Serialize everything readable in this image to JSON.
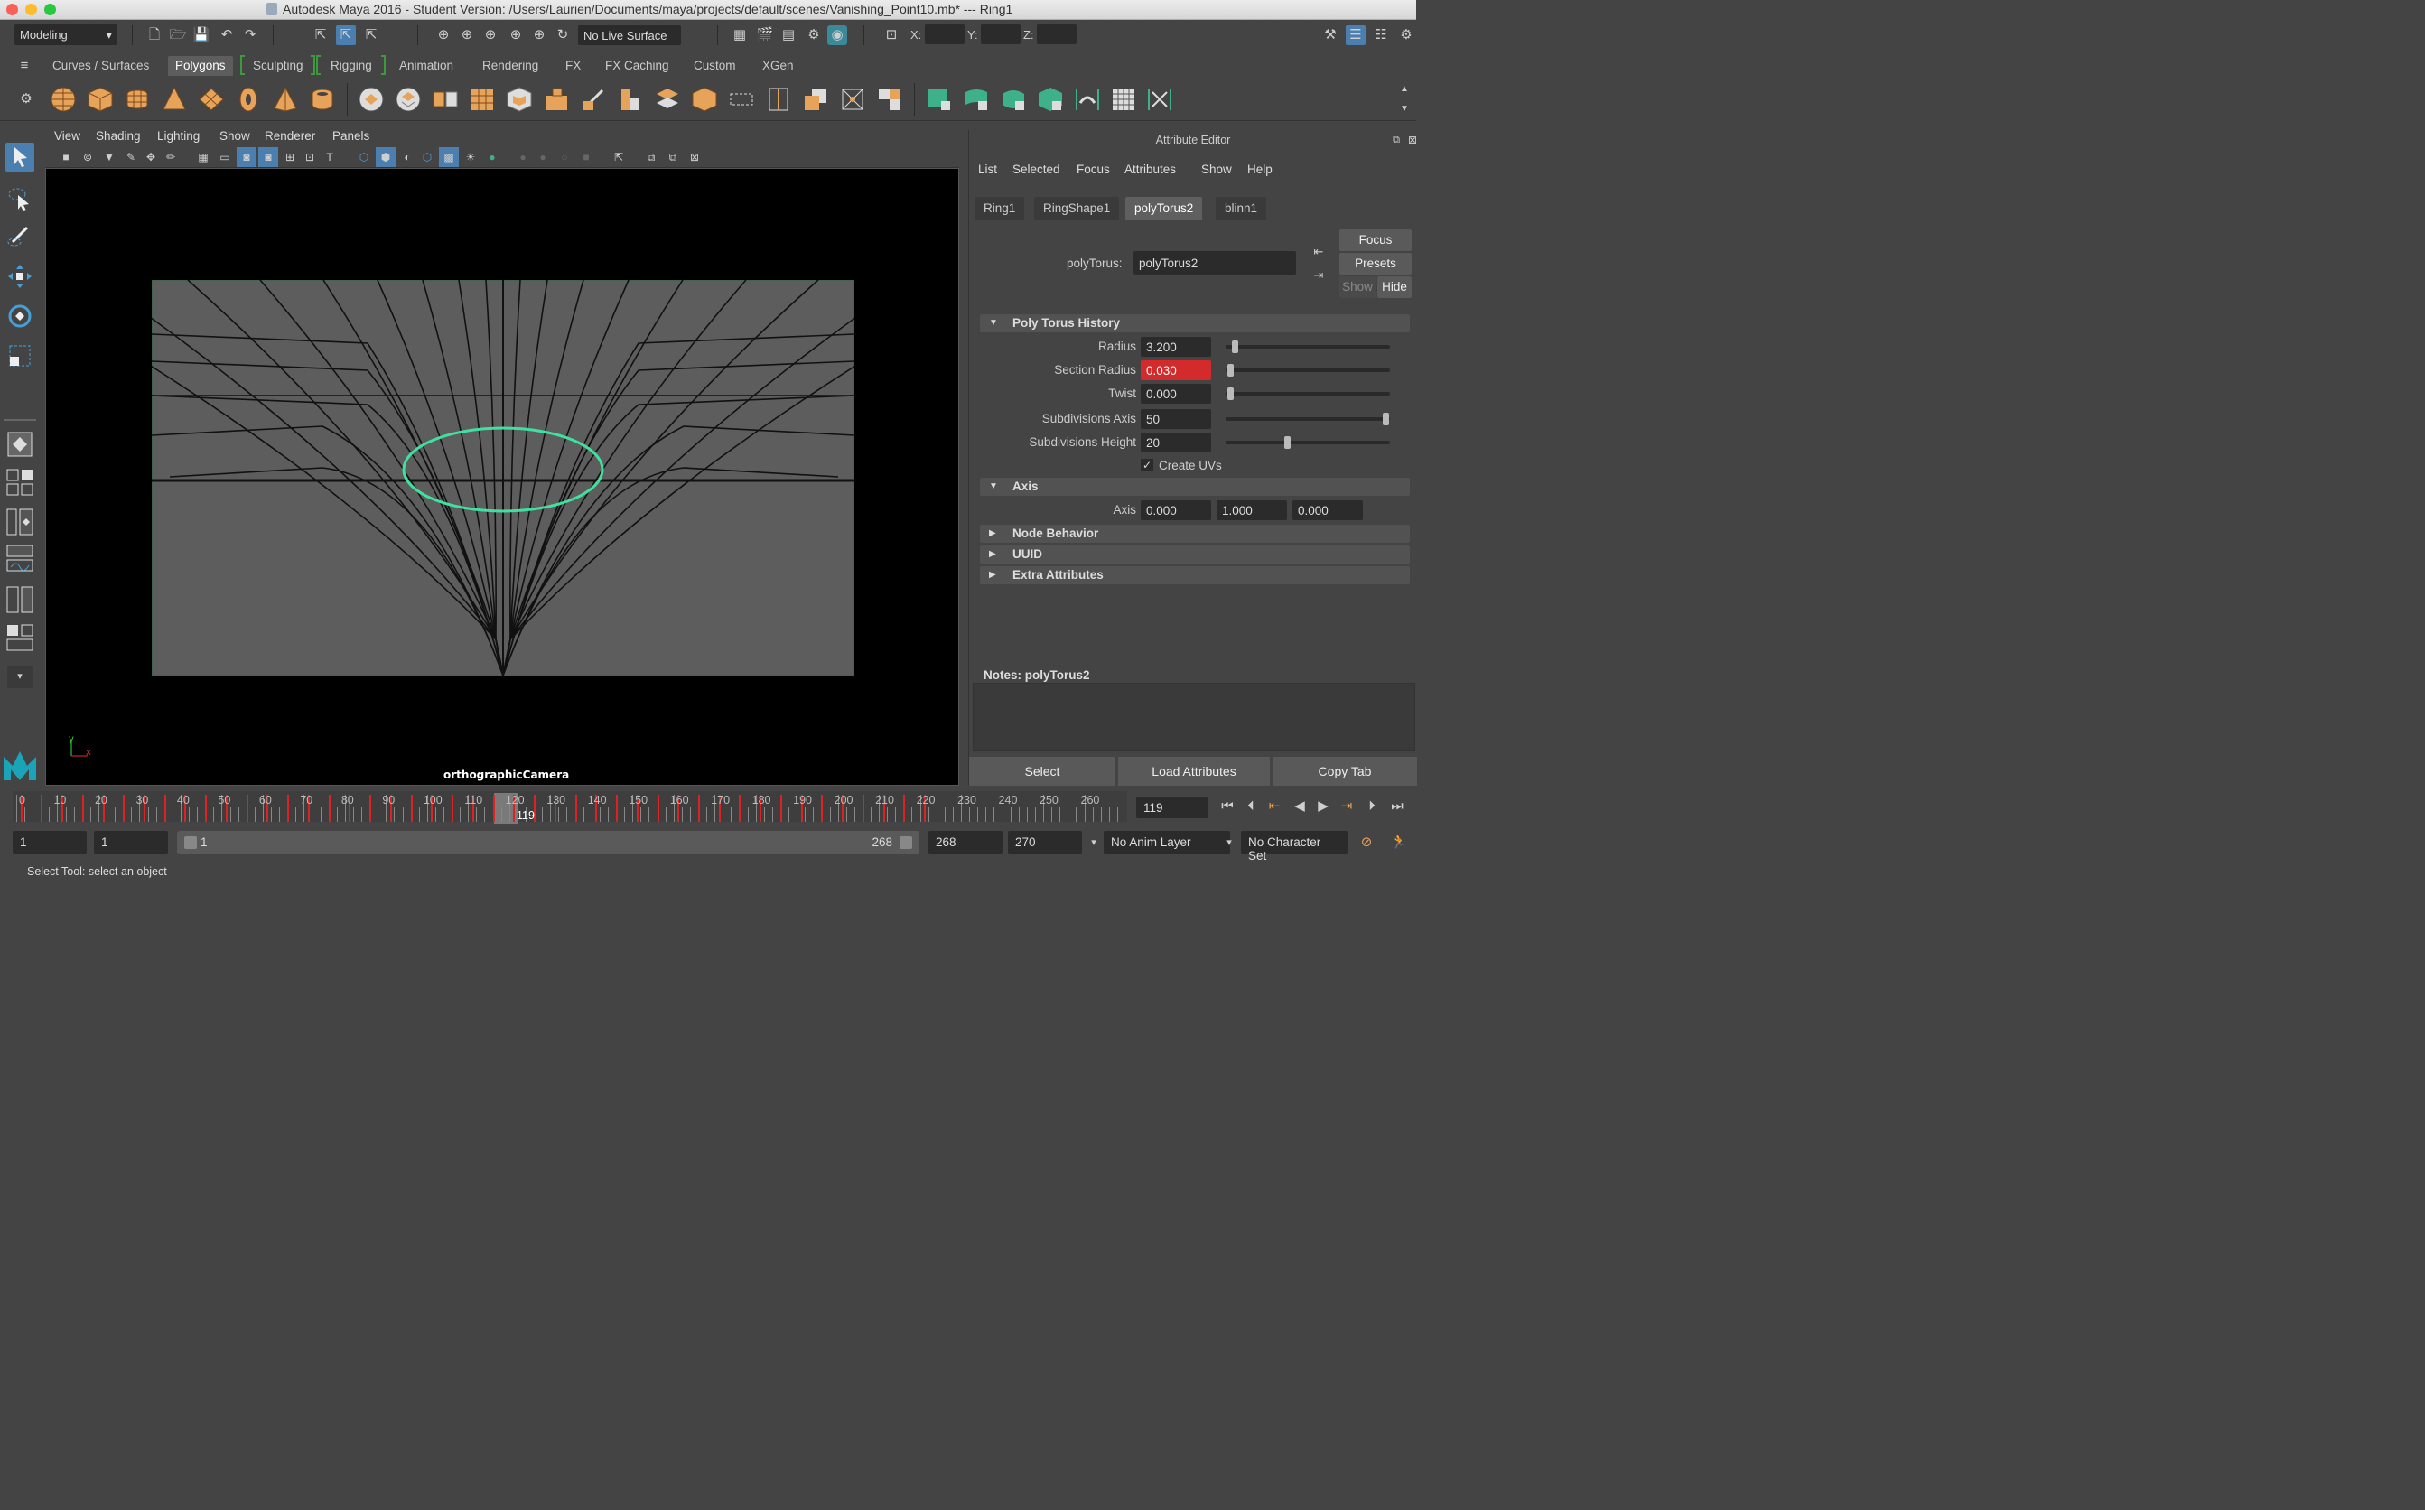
{
  "window": {
    "title": "Autodesk Maya 2016 - Student Version: /Users/Laurien/Documents/maya/projects/default/scenes/Vanishing_Point10.mb*   ---   Ring1"
  },
  "status_line": {
    "menu_set": "Modeling",
    "live_surface": "No Live Surface",
    "x_label": "X:",
    "y_label": "Y:",
    "z_label": "Z:"
  },
  "shelf_tabs": [
    "Curves / Surfaces",
    "Polygons",
    "Sculpting",
    "Rigging",
    "Animation",
    "Rendering",
    "FX",
    "FX Caching",
    "Custom",
    "XGen"
  ],
  "shelf_active_tab": "Polygons",
  "viewport": {
    "menus": [
      "View",
      "Shading",
      "Lighting",
      "Show",
      "Renderer",
      "Panels"
    ],
    "camera_label": "orthographicCamera",
    "axis_y": "y",
    "axis_x": "x"
  },
  "attribute_editor": {
    "title": "Attribute Editor",
    "menus": [
      "List",
      "Selected",
      "Focus",
      "Attributes",
      "Show",
      "Help"
    ],
    "tabs": [
      "Ring1",
      "RingShape1",
      "polyTorus2",
      "blinn1"
    ],
    "active_tab": "polyTorus2",
    "node_label": "polyTorus:",
    "node_name": "polyTorus2",
    "focus_btn": "Focus",
    "presets_btn": "Presets",
    "show_btn": "Show",
    "hide_btn": "Hide",
    "section_history": "Poly Torus History",
    "attrs": {
      "radius_label": "Radius",
      "radius": "3.200",
      "section_radius_label": "Section Radius",
      "section_radius": "0.030",
      "twist_label": "Twist",
      "twist": "0.000",
      "subdiv_axis_label": "Subdivisions Axis",
      "subdiv_axis": "50",
      "subdiv_height_label": "Subdivisions Height",
      "subdiv_height": "20",
      "create_uvs_label": "Create UVs"
    },
    "section_axis": "Axis",
    "axis_label": "Axis",
    "axis_values": [
      "0.000",
      "1.000",
      "0.000"
    ],
    "section_node_behavior": "Node Behavior",
    "section_uuid": "UUID",
    "section_extra": "Extra Attributes",
    "notes_label": "Notes:  polyTorus2",
    "btn_select": "Select",
    "btn_load": "Load Attributes",
    "btn_copy": "Copy Tab"
  },
  "time_slider": {
    "ticks": [
      "10",
      "20",
      "30",
      "40",
      "50",
      "60",
      "70",
      "80",
      "90",
      "100",
      "110",
      "120",
      "130",
      "140",
      "150",
      "160",
      "170",
      "180",
      "190",
      "200",
      "210",
      "220",
      "230",
      "240",
      "250",
      "260"
    ],
    "first_tick": "0",
    "current_frame": "119",
    "current_frame_field": "119"
  },
  "range_slider": {
    "start_time": "1",
    "playback_start": "1",
    "range_start": "1",
    "range_end": "268",
    "playback_end": "268",
    "end_time": "270",
    "anim_layer": "No Anim Layer",
    "character_set": "No Character Set"
  },
  "help_line": "Select Tool: select an object",
  "colors": {
    "accent_blue": "#4a9ed6",
    "shelf_orange": "#e8a35a",
    "selection_green": "#40e0a0",
    "key_red": "#dd2222",
    "warn_field": "#d32b2b"
  }
}
